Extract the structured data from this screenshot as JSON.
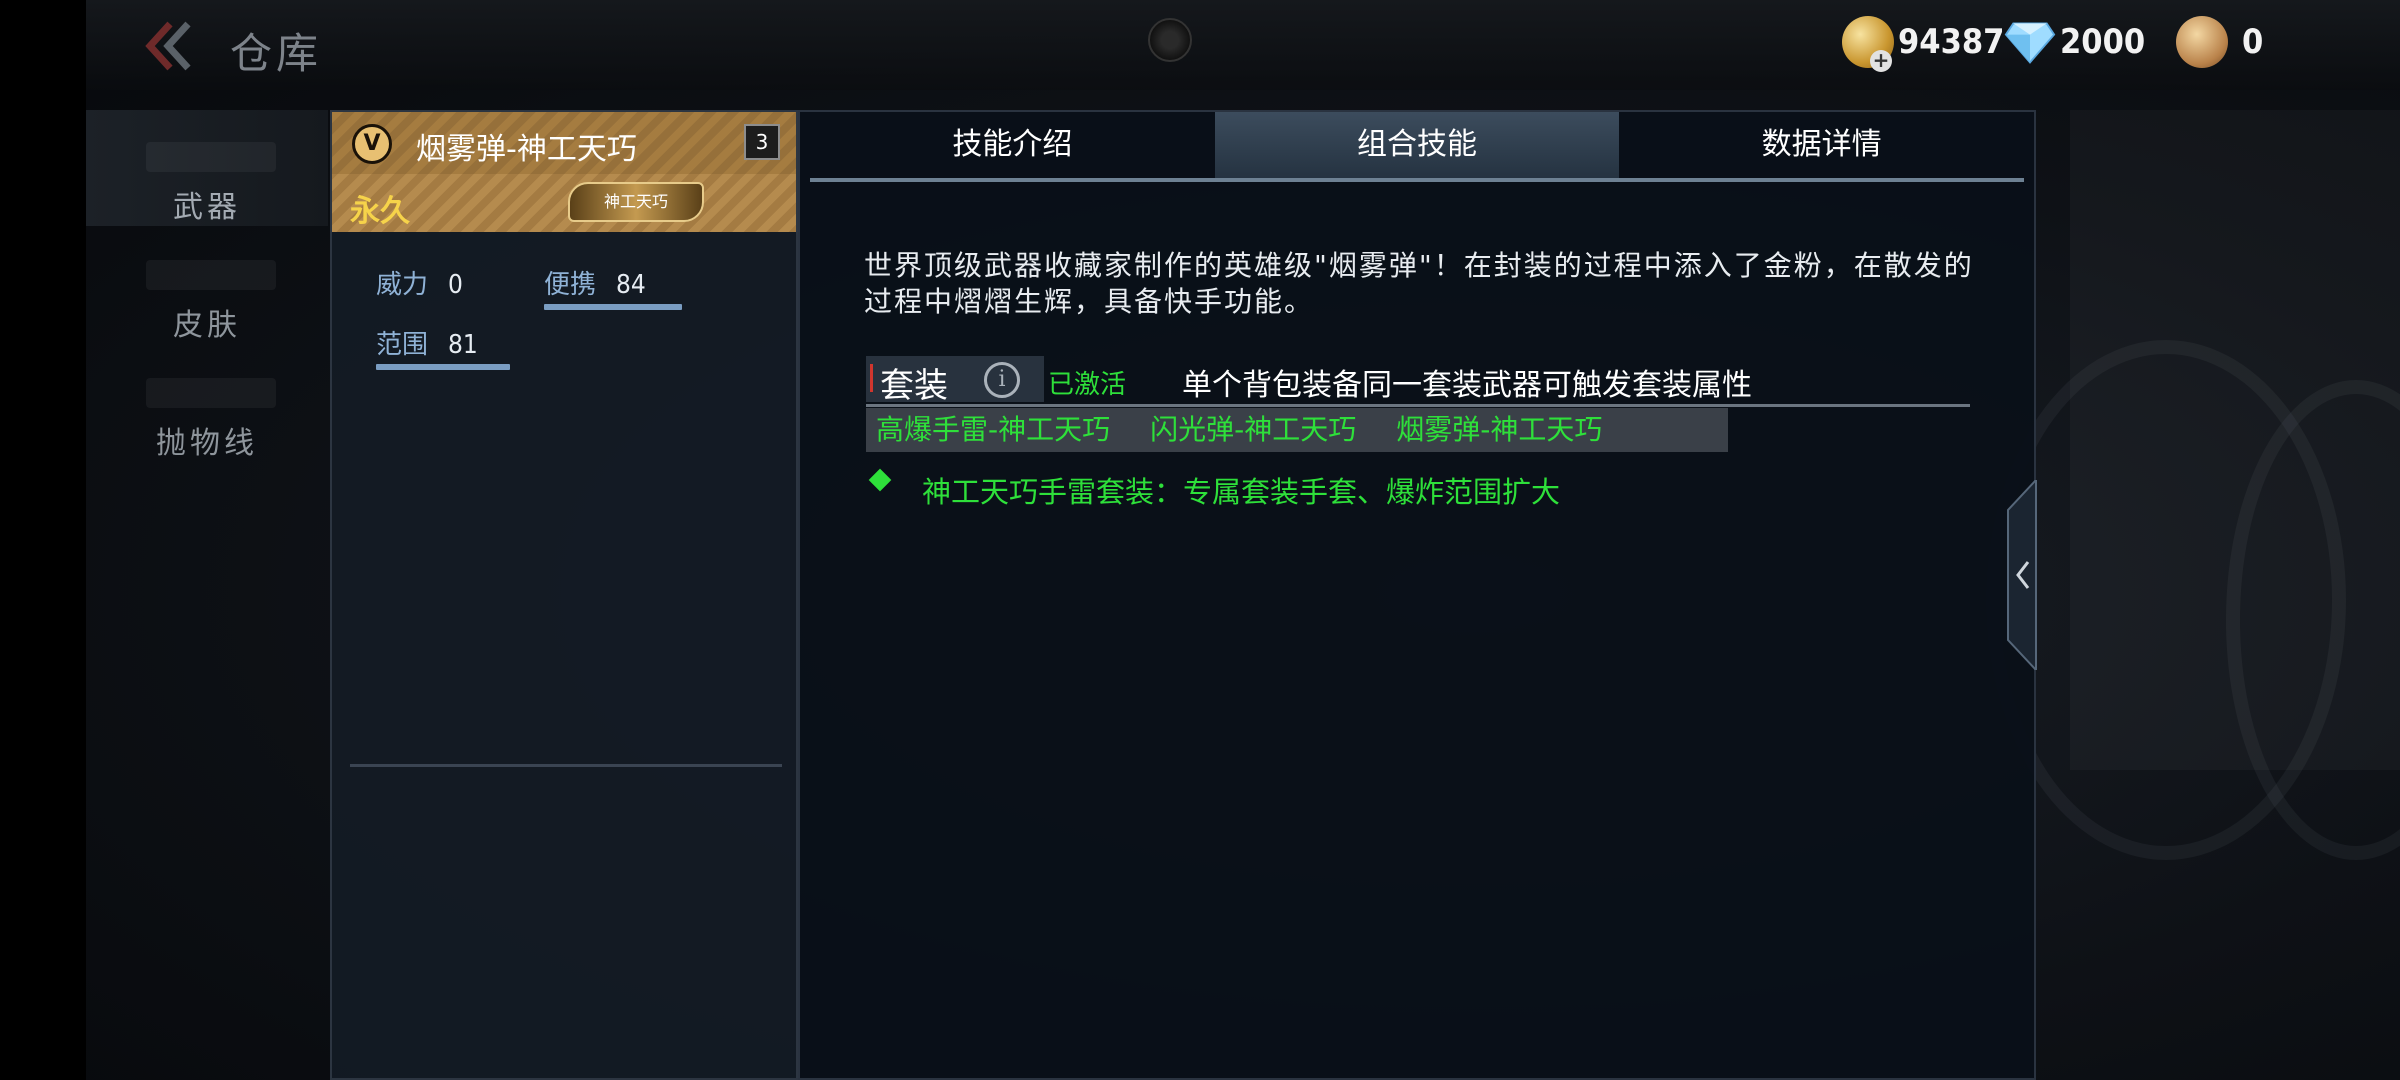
{
  "header": {
    "title": "仓库",
    "currencies": [
      {
        "icon": "gold-coin-icon",
        "value": "94387"
      },
      {
        "icon": "diamond-icon",
        "value": "2000"
      },
      {
        "icon": "medal-icon",
        "value": "0"
      }
    ]
  },
  "sidebar": {
    "items": [
      {
        "label": "武器",
        "active": true
      },
      {
        "label": "皮肤",
        "active": false
      },
      {
        "label": "抛物线",
        "active": false
      }
    ]
  },
  "item": {
    "rank_icon": "V",
    "name": "烟雾弹-神工天巧",
    "level": "3",
    "duration": "永久",
    "badge": "神工天巧",
    "stats": [
      {
        "label": "威力",
        "value": "0"
      },
      {
        "label": "便携",
        "value": "84"
      },
      {
        "label": "范围",
        "value": "81"
      }
    ]
  },
  "tabs": [
    {
      "label": "技能介绍",
      "active": false
    },
    {
      "label": "组合技能",
      "active": true
    },
    {
      "label": "数据详情",
      "active": false
    }
  ],
  "detail": {
    "description": "世界顶级武器收藏家制作的英雄级\"烟雾弹\"！在封装的过程中添入了金粉，在散发的过程中熠熠生辉，具备快手功能。",
    "set_label": "套装",
    "set_status": "已激活",
    "set_description": "单个背包装备同一套装武器可触发套装属性",
    "set_items": [
      "高爆手雷-神工天巧",
      "闪光弹-神工天巧",
      "烟雾弹-神工天巧"
    ],
    "set_bonus": "神工天巧手雷套装：专属套装手套、爆炸范围扩大"
  },
  "colors": {
    "accent_green": "#2ee03a",
    "gold": "#f6d34a",
    "stat_blue": "#8fb2d6"
  }
}
